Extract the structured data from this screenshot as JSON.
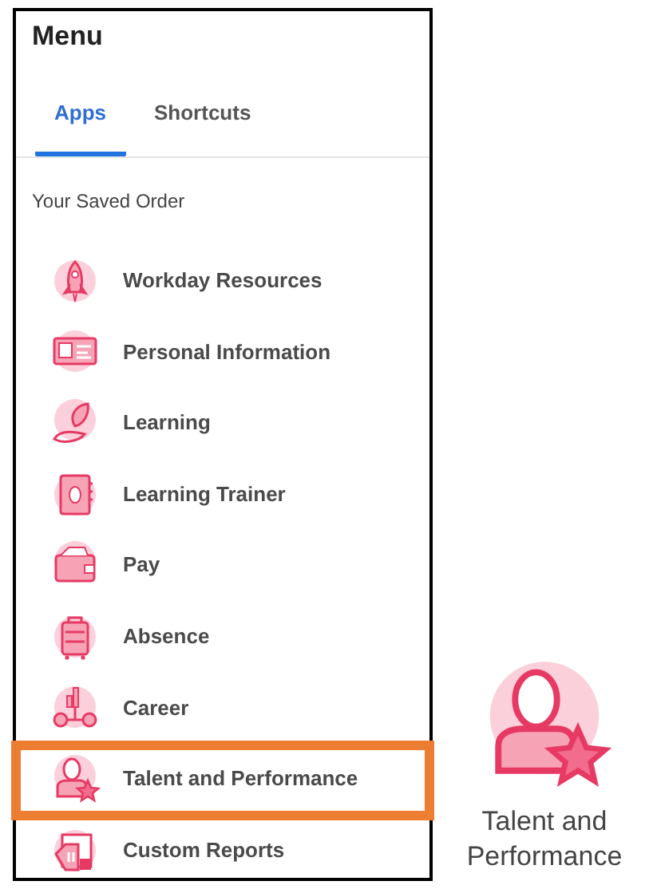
{
  "title": "Menu",
  "tabs": [
    {
      "label": "Apps",
      "selected": true
    },
    {
      "label": "Shortcuts",
      "selected": false
    }
  ],
  "section_label": "Your Saved Order",
  "apps": [
    {
      "label": "Workday Resources",
      "kind": "rocket",
      "highlighted": false
    },
    {
      "label": "Personal Information",
      "kind": "card",
      "highlighted": false
    },
    {
      "label": "Learning",
      "kind": "leaf",
      "highlighted": false
    },
    {
      "label": "Learning Trainer",
      "kind": "notebook",
      "highlighted": false
    },
    {
      "label": "Pay",
      "kind": "wallet",
      "highlighted": false
    },
    {
      "label": "Absence",
      "kind": "suitcase",
      "highlighted": false
    },
    {
      "label": "Career",
      "kind": "career",
      "highlighted": false
    },
    {
      "label": "Talent and Performance",
      "kind": "talent",
      "highlighted": true
    },
    {
      "label": "Custom Reports",
      "kind": "report",
      "highlighted": false
    }
  ],
  "featured_app": {
    "label": "Talent and Performance",
    "kind": "talent"
  }
}
